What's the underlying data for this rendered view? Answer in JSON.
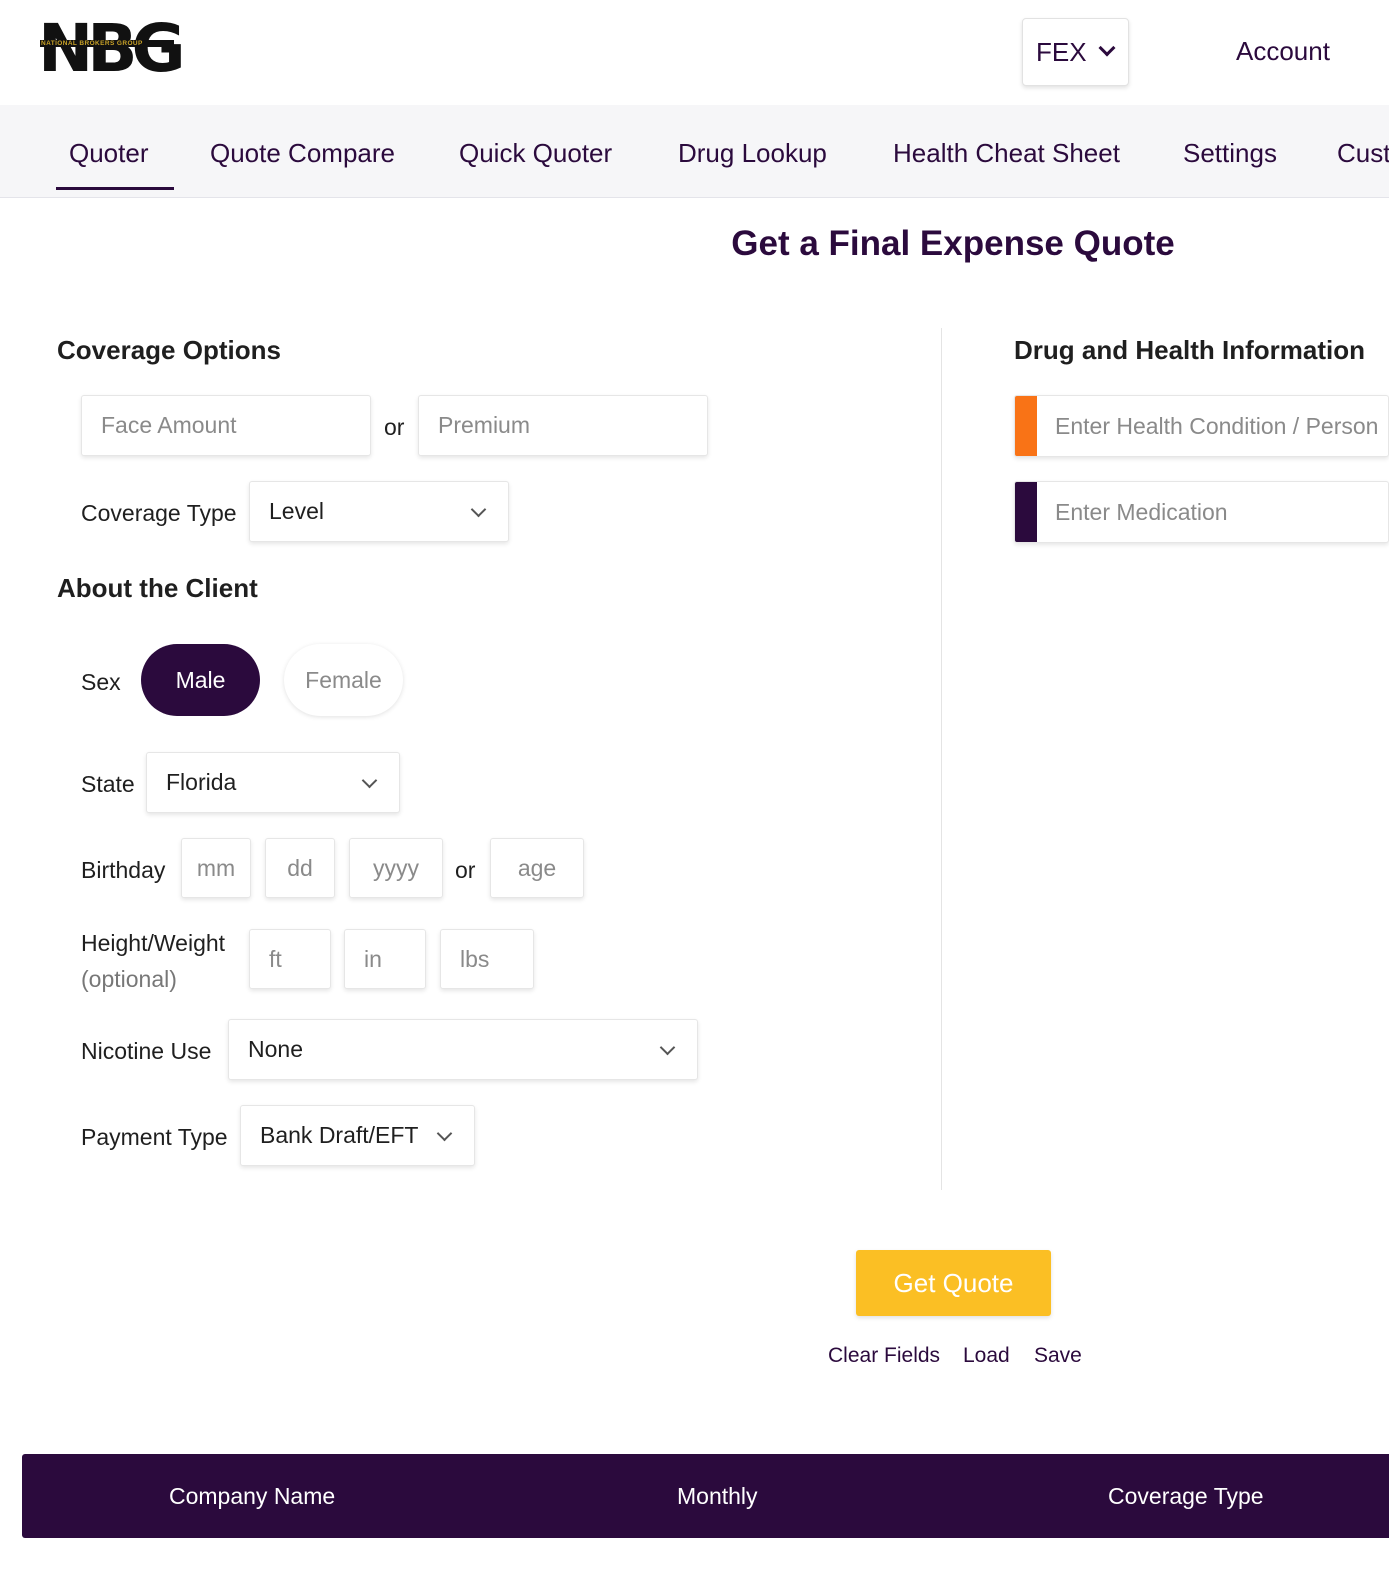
{
  "header": {
    "logo_text": "NBG",
    "logo_subtext": "NATIONAL BROKERS GROUP",
    "product_selector": "FEX",
    "account_label": "Account"
  },
  "nav": {
    "tabs": [
      {
        "label": "Quoter",
        "active": true
      },
      {
        "label": "Quote Compare"
      },
      {
        "label": "Quick Quoter"
      },
      {
        "label": "Drug Lookup"
      },
      {
        "label": "Health Cheat Sheet"
      },
      {
        "label": "Settings"
      },
      {
        "label": "Cust"
      }
    ]
  },
  "page": {
    "title": "Get a Final Expense Quote"
  },
  "coverage": {
    "section_title": "Coverage Options",
    "face_amount_placeholder": "Face Amount",
    "or_text": "or",
    "premium_placeholder": "Premium",
    "coverage_type_label": "Coverage Type",
    "coverage_type_value": "Level"
  },
  "client": {
    "section_title": "About the Client",
    "sex_label": "Sex",
    "sex_options": [
      "Male",
      "Female"
    ],
    "sex_selected": "Male",
    "state_label": "State",
    "state_value": "Florida",
    "birthday_label": "Birthday",
    "birthday_placeholders": {
      "month": "mm",
      "day": "dd",
      "year": "yyyy",
      "age": "age"
    },
    "or_text": "or",
    "height_weight_label": "Height/Weight",
    "optional_text": "(optional)",
    "height_weight_placeholders": {
      "feet": "ft",
      "inches": "in",
      "pounds": "lbs"
    },
    "nicotine_label": "Nicotine Use",
    "nicotine_value": "None",
    "payment_label": "Payment Type",
    "payment_value": "Bank Draft/EFT"
  },
  "health": {
    "section_title": "Drug and Health Information",
    "condition_placeholder": "Enter Health Condition / Person",
    "medication_placeholder": "Enter Medication",
    "condition_tag_color": "#f97316",
    "medication_tag_color": "#2b0a3d"
  },
  "actions": {
    "get_quote": "Get Quote",
    "clear_fields": "Clear Fields",
    "load": "Load",
    "save": "Save"
  },
  "results": {
    "columns": [
      "Company Name",
      "Monthly",
      "Coverage Type"
    ]
  },
  "colors": {
    "brand_purple": "#2b0a3d",
    "accent_yellow": "#fbbf24",
    "accent_orange": "#f97316"
  }
}
